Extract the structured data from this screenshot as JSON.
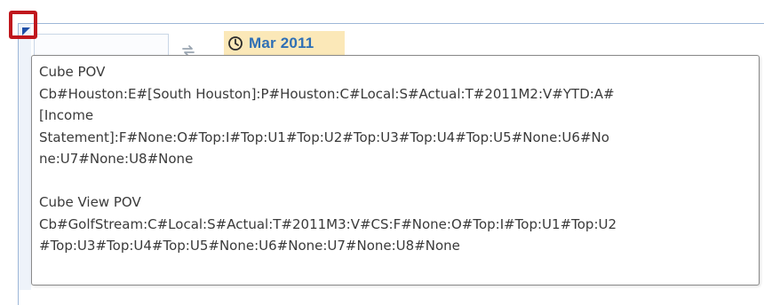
{
  "header": {
    "time_label": "Mar 2011",
    "time_icon": "clock-icon",
    "refresh_icon": "refresh-icon",
    "corner_icon": "corner-indicator-icon"
  },
  "colors": {
    "accent_text": "#2e6fb5",
    "time_header_bg": "#fbe8b8",
    "highlight_border": "#c0171d",
    "grid_line": "#9db7d8"
  },
  "tooltip": {
    "cube_pov": {
      "title": "Cube POV",
      "lines": [
        "Cb#Houston:E#[South Houston]:P#Houston:C#Local:S#Actual:T#2011M2:V#YTD:A#",
        "[Income",
        "Statement]:F#None:O#Top:I#Top:U1#Top:U2#Top:U3#Top:U4#Top:U5#None:U6#No",
        "ne:U7#None:U8#None"
      ]
    },
    "cube_view_pov": {
      "title": "Cube View POV",
      "lines": [
        "Cb#GolfStream:C#Local:S#Actual:T#2011M3:V#CS:F#None:O#Top:I#Top:U1#Top:U2",
        "#Top:U3#Top:U4#Top:U5#None:U6#None:U7#None:U8#None"
      ]
    }
  }
}
